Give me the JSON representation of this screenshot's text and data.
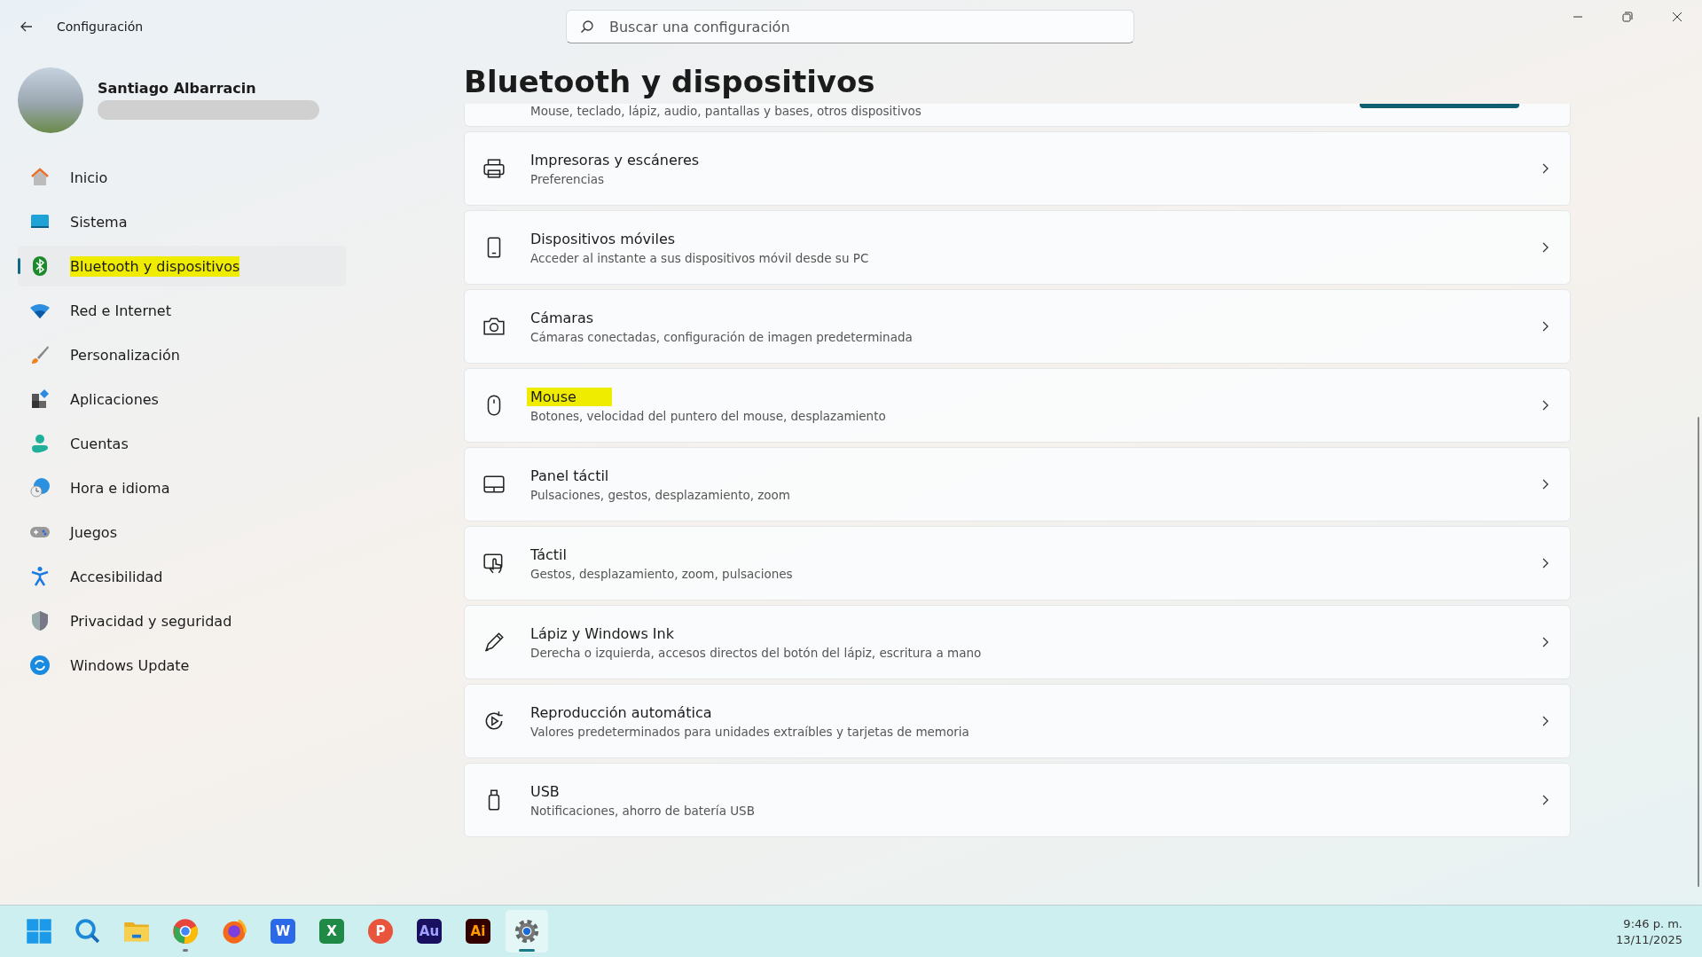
{
  "window": {
    "title": "Configuración"
  },
  "search": {
    "placeholder": "Buscar una configuración"
  },
  "user": {
    "name": "Santiago Albarracin"
  },
  "sidebar": {
    "items": [
      {
        "label": "Inicio",
        "kind": "home",
        "selected": false,
        "highlighted": false
      },
      {
        "label": "Sistema",
        "kind": "system",
        "selected": false,
        "highlighted": false
      },
      {
        "label": "Bluetooth y dispositivos",
        "kind": "bluetooth",
        "selected": true,
        "highlighted": true
      },
      {
        "label": "Red e Internet",
        "kind": "wifi",
        "selected": false,
        "highlighted": false
      },
      {
        "label": "Personalización",
        "kind": "brush",
        "selected": false,
        "highlighted": false
      },
      {
        "label": "Aplicaciones",
        "kind": "apps",
        "selected": false,
        "highlighted": false
      },
      {
        "label": "Cuentas",
        "kind": "person",
        "selected": false,
        "highlighted": false
      },
      {
        "label": "Hora e idioma",
        "kind": "globe",
        "selected": false,
        "highlighted": false
      },
      {
        "label": "Juegos",
        "kind": "gamepad",
        "selected": false,
        "highlighted": false
      },
      {
        "label": "Accesibilidad",
        "kind": "access",
        "selected": false,
        "highlighted": false
      },
      {
        "label": "Privacidad y seguridad",
        "kind": "shield",
        "selected": false,
        "highlighted": false
      },
      {
        "label": "Windows Update",
        "kind": "update",
        "selected": false,
        "highlighted": false
      }
    ]
  },
  "page": {
    "title": "Bluetooth y dispositivos",
    "partial_card": {
      "subtitle": "Mouse, teclado, lápiz, audio, pantallas y bases, otros dispositivos"
    },
    "cards": [
      {
        "kind": "printer",
        "title": "Impresoras y escáneres",
        "subtitle": "Preferencias",
        "highlighted": false
      },
      {
        "kind": "phone",
        "title": "Dispositivos móviles",
        "subtitle": "Acceder al instante a sus dispositivos móvil desde su PC",
        "highlighted": false
      },
      {
        "kind": "camera",
        "title": "Cámaras",
        "subtitle": "Cámaras conectadas, configuración de imagen predeterminada",
        "highlighted": false
      },
      {
        "kind": "mouse",
        "title": "Mouse",
        "subtitle": "Botones, velocidad del puntero del mouse, desplazamiento",
        "highlighted": true
      },
      {
        "kind": "touchpad",
        "title": "Panel táctil",
        "subtitle": "Pulsaciones, gestos, desplazamiento, zoom",
        "highlighted": false
      },
      {
        "kind": "touch",
        "title": "Táctil",
        "subtitle": "Gestos, desplazamiento, zoom, pulsaciones",
        "highlighted": false
      },
      {
        "kind": "pen",
        "title": "Lápiz y Windows Ink",
        "subtitle": "Derecha o izquierda, accesos directos del botón del lápiz, escritura a mano",
        "highlighted": false
      },
      {
        "kind": "autoplay",
        "title": "Reproducción automática",
        "subtitle": "Valores predeterminados para unidades extraíbles y tarjetas de memoria",
        "highlighted": false
      },
      {
        "kind": "usb",
        "title": "USB",
        "subtitle": "Notificaciones, ahorro de batería USB",
        "highlighted": false
      }
    ]
  },
  "taskbar": {
    "apps": [
      {
        "kind": "start",
        "selected": false,
        "running": false
      },
      {
        "kind": "search",
        "selected": false,
        "running": false
      },
      {
        "kind": "files",
        "selected": false,
        "running": false
      },
      {
        "kind": "chrome",
        "selected": false,
        "running": true
      },
      {
        "kind": "firefox",
        "selected": false,
        "running": false
      },
      {
        "kind": "word",
        "selected": false,
        "running": false,
        "letter": "W"
      },
      {
        "kind": "excel",
        "selected": false,
        "running": false,
        "letter": "X"
      },
      {
        "kind": "powerpoint",
        "selected": false,
        "running": false,
        "letter": "P"
      },
      {
        "kind": "audition",
        "selected": false,
        "running": false,
        "letter": "Au"
      },
      {
        "kind": "illustrator",
        "selected": false,
        "running": false,
        "letter": "Ai"
      },
      {
        "kind": "settings",
        "selected": true,
        "running": true
      }
    ],
    "time": "9:46 p. m.",
    "date": "13/11/2025"
  }
}
